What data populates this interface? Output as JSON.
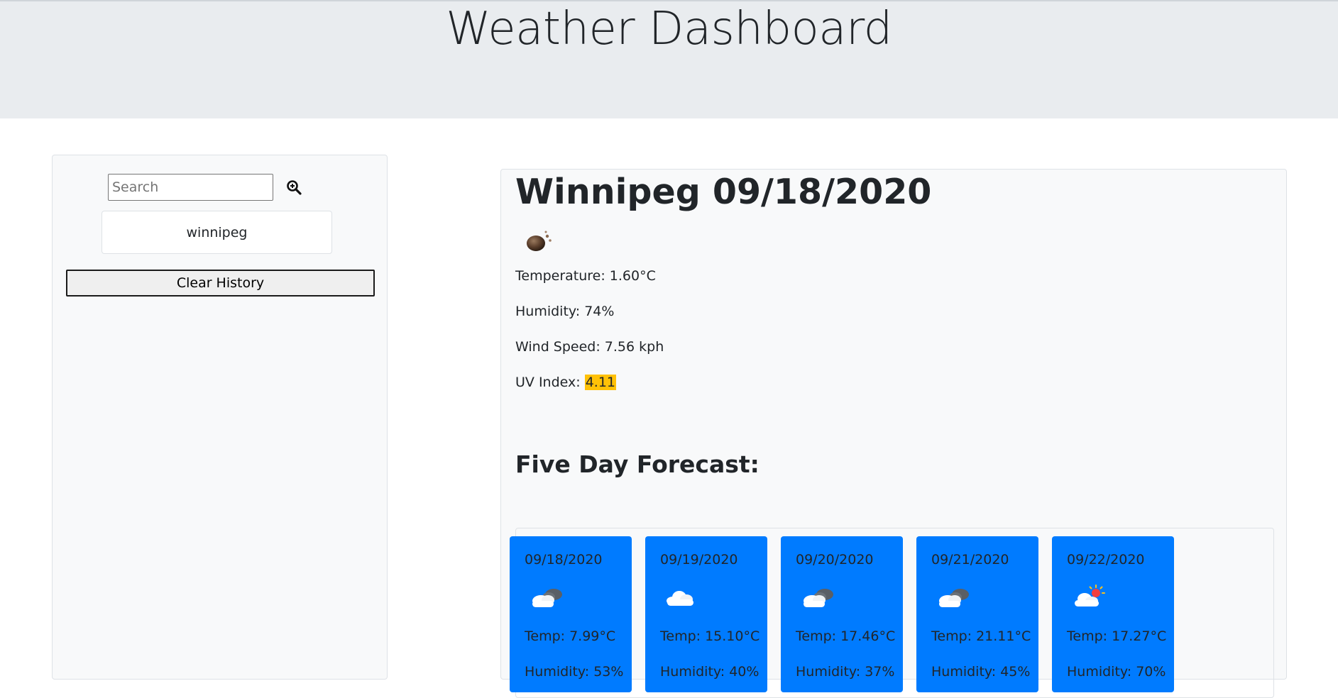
{
  "header": {
    "title": "Weather Dashboard"
  },
  "sidebar": {
    "search_placeholder": "Search",
    "search_value": "",
    "search_icon": "zoom-in-icon",
    "history": [
      "winnipeg"
    ],
    "clear_label": "Clear History"
  },
  "current": {
    "title": "Winnipeg 09/18/2020",
    "icon": "new-moon-icon",
    "temperature": "Temperature: 1.60°C",
    "humidity": "Humidity: 74%",
    "wind": "Wind Speed: 7.56 kph",
    "uv_label": "UV Index: ",
    "uv_value": "4.11",
    "uv_color": "#ffc107"
  },
  "forecast": {
    "heading": "Five Day Forecast:",
    "card_color": "#007bff",
    "days": [
      {
        "date": "09/18/2020",
        "icon": "cloud-dark-icon",
        "temp": "Temp: 7.99°C",
        "humidity": "Humidity: 53%"
      },
      {
        "date": "09/19/2020",
        "icon": "cloud-icon",
        "temp": "Temp: 15.10°C",
        "humidity": "Humidity: 40%"
      },
      {
        "date": "09/20/2020",
        "icon": "cloud-dark-icon",
        "temp": "Temp: 17.46°C",
        "humidity": "Humidity: 37%"
      },
      {
        "date": "09/21/2020",
        "icon": "cloud-dark-icon",
        "temp": "Temp: 21.11°C",
        "humidity": "Humidity: 45%"
      },
      {
        "date": "09/22/2020",
        "icon": "cloud-sun-icon",
        "temp": "Temp: 17.27°C",
        "humidity": "Humidity: 70%"
      }
    ]
  }
}
